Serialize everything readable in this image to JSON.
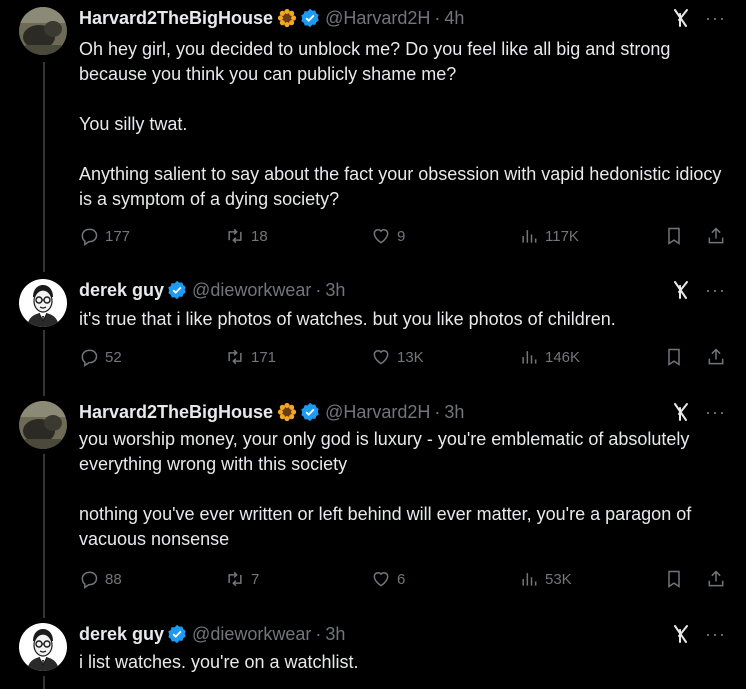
{
  "tweets": [
    {
      "name": "Harvard2TheBigHouse",
      "badge_icon": "sunflower-icon",
      "handle": "@Harvard2H",
      "time": "4h",
      "text": "Oh hey girl, you decided to unblock me? Do you feel like all big and strong because you think you can publicly shame me?\n\nYou silly twat.\n\nAnything salient to say about the fact your obsession with vapid hedonistic idiocy is a symptom of a dying society?",
      "replies": "177",
      "reposts": "18",
      "likes": "9",
      "views": "117K"
    },
    {
      "name": "derek guy",
      "handle": "@dieworkwear",
      "time": "3h",
      "text": "it's true that i like photos of watches. but you like photos of children.",
      "replies": "52",
      "reposts": "171",
      "likes": "13K",
      "views": "146K"
    },
    {
      "name": "Harvard2TheBigHouse",
      "badge_icon": "sunflower-icon",
      "handle": "@Harvard2H",
      "time": "3h",
      "text": "you worship money, your only god is luxury - you're emblematic of absolutely everything wrong with this society\n\nnothing you've ever written or left behind will ever matter, you're a paragon of vacuous nonsense",
      "replies": "88",
      "reposts": "7",
      "likes": "6",
      "views": "53K"
    },
    {
      "name": "derek guy",
      "handle": "@dieworkwear",
      "time": "3h",
      "text": "i list watches. you're on a watchlist."
    }
  ],
  "separator": "·",
  "more_glyph": "···",
  "colors": {
    "background": "#000000",
    "text": "#e7e9ea",
    "muted": "#71767b",
    "verified": "#1d9bf0",
    "thread_line": "#333639"
  }
}
